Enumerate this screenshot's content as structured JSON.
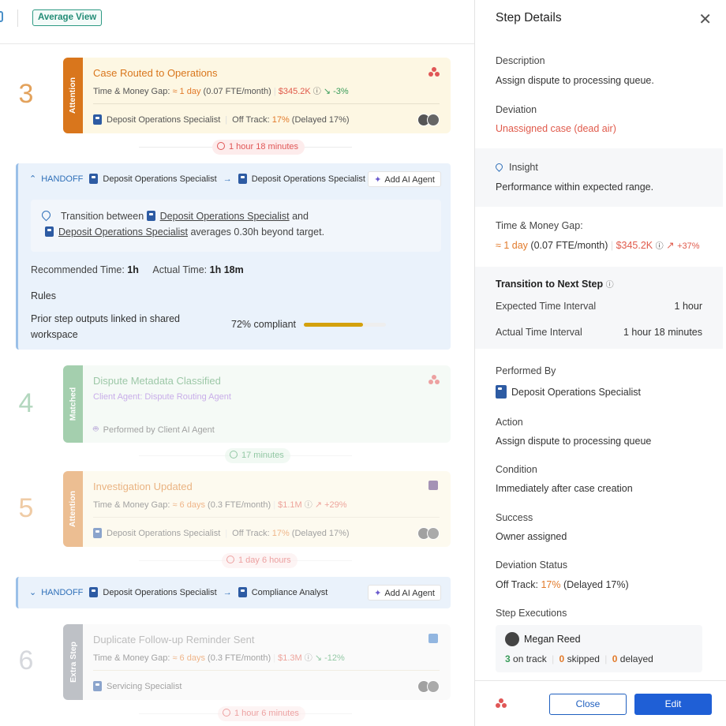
{
  "toolbar": {
    "average_view": "Average View"
  },
  "steps": [
    {
      "number": "3",
      "badge": "Attention",
      "title": "Case Routed to Operations",
      "gap_label": "Time & Money Gap:",
      "gap_time": "≈ 1 day",
      "gap_fte": "(0.07 FTE/month)",
      "gap_money": "$345.2K",
      "gap_trend": "-3%",
      "performer": "Deposit Operations Specialist",
      "track_label": "Off Track:",
      "track_pct": "17%",
      "track_delay": "(Delayed 17%)"
    },
    {
      "number": "4",
      "badge": "Matched",
      "title": "Dispute Metadata Classified",
      "client_agent": "Client Agent: Dispute Routing Agent",
      "performed_by": "Performed by Client AI Agent"
    },
    {
      "number": "5",
      "badge": "Attention",
      "title": "Investigation Updated",
      "gap_label": "Time & Money Gap:",
      "gap_time": "≈ 6 days",
      "gap_fte": "(0.3 FTE/month)",
      "gap_money": "$1.1M",
      "gap_trend": "+29%",
      "performer": "Deposit Operations Specialist",
      "track_label": "Off Track:",
      "track_pct": "17%",
      "track_delay": "(Delayed 17%)"
    },
    {
      "number": "6",
      "badge": "Extra Step",
      "title": "Duplicate Follow-up Reminder Sent",
      "gap_label": "Time & Money Gap:",
      "gap_time": "≈ 6 days",
      "gap_fte": "(0.3 FTE/month)",
      "gap_money": "$1.3M",
      "gap_trend": "-12%",
      "performer": "Servicing Specialist"
    }
  ],
  "durations": [
    "1 hour 18 minutes",
    "17 minutes",
    "1 day 6 hours",
    "1 hour 6 minutes"
  ],
  "handoffs": [
    {
      "label": "HANDOFF",
      "from": "Deposit Operations Specialist",
      "to": "Deposit Operations Specialist",
      "add_ai": "Add AI Agent",
      "insight_pre": "Transition between",
      "insight_a": "Deposit Operations Specialist",
      "insight_and": "and",
      "insight_b": "Deposit Operations Specialist",
      "insight_post": "averages 0.30h beyond target.",
      "rec_label": "Recommended Time:",
      "rec_value": "1h",
      "act_label": "Actual Time:",
      "act_value": "1h 18m",
      "rules_label": "Rules",
      "rule_text": "Prior step outputs linked in shared workspace",
      "compliance": "72% compliant",
      "compliance_fraction": 0.72
    },
    {
      "label": "HANDOFF",
      "from": "Deposit Operations Specialist",
      "to": "Compliance Analyst",
      "add_ai": "Add AI Agent"
    }
  ],
  "details": {
    "title": "Step Details",
    "description_label": "Description",
    "description": "Assign dispute to processing queue.",
    "deviation_label": "Deviation",
    "deviation": "Unassigned case (dead air)",
    "insight_label": "Insight",
    "insight": "Performance within expected range.",
    "gap_label": "Time & Money Gap:",
    "gap_time": "≈ 1 day",
    "gap_fte": "(0.07 FTE/month)",
    "gap_money": "$345.2K",
    "gap_trend": "+37%",
    "transition_label": "Transition to Next Step",
    "expected_label": "Expected Time Interval",
    "expected_value": "1 hour",
    "actual_label": "Actual Time Interval",
    "actual_value": "1 hour 18 minutes",
    "performed_label": "Performed By",
    "performed": "Deposit Operations Specialist",
    "action_label": "Action",
    "action": "Assign dispute to processing queue",
    "condition_label": "Condition",
    "condition": "Immediately after case creation",
    "success_label": "Success",
    "success": "Owner assigned",
    "devstatus_label": "Deviation Status",
    "devstatus_track": "Off Track:",
    "devstatus_pct": "17%",
    "devstatus_delay": "(Delayed 17%)",
    "exec_label": "Step Executions",
    "exec_user": "Megan Reed",
    "exec_on": "3",
    "exec_on_label": "on track",
    "exec_skip": "0",
    "exec_skip_label": "skipped",
    "exec_del": "0",
    "exec_del_label": "delayed",
    "close_btn": "Close",
    "edit_btn": "Edit"
  },
  "colors": {
    "attention": "#d9761c",
    "matched": "#5aa86c",
    "extra": "#8a8f99",
    "primary": "#1f5fd6"
  }
}
